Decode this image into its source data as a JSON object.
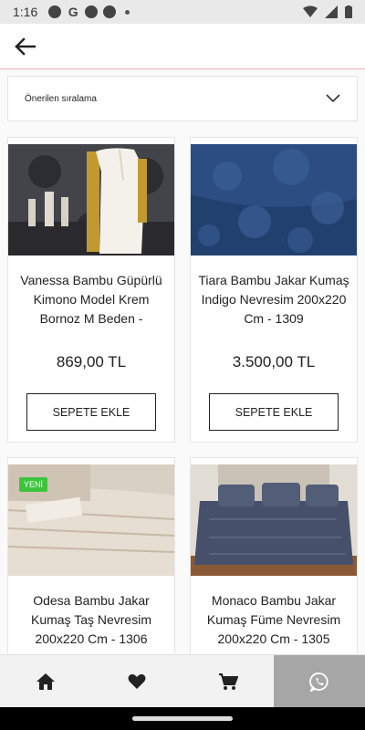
{
  "status_bar": {
    "time": "1:16",
    "g_label": "G"
  },
  "sort": {
    "label": "Önerilen sıralama"
  },
  "products": [
    {
      "title": "Vanessa Bambu Güpürlü Kimono Model Krem Bornoz M Beden -",
      "price": "869,00 TL",
      "button": "SEPETE EKLE",
      "badge": "",
      "image_icon": "bathrobe-photo"
    },
    {
      "title": "Tiara Bambu Jakar Kumaş Indigo Nevresim 200x220 Cm - 1309",
      "price": "3.500,00 TL",
      "button": "SEPETE EKLE",
      "badge": "",
      "image_icon": "duvet-indigo-photo"
    },
    {
      "title": "Odesa Bambu Jakar Kumaş Taş Nevresim 200x220 Cm - 1306",
      "price": "",
      "button": "",
      "badge": "YENİ",
      "image_icon": "duvet-stone-photo"
    },
    {
      "title": "Monaco Bambu Jakar Kumaş Füme Nevresim 200x220 Cm - 1305",
      "price": "",
      "button": "",
      "badge": "",
      "image_icon": "duvet-smoke-photo"
    }
  ],
  "nav": [
    {
      "icon": "home-icon"
    },
    {
      "icon": "heart-icon"
    },
    {
      "icon": "cart-icon"
    },
    {
      "icon": "whatsapp-icon",
      "active": true
    }
  ],
  "colors": {
    "badge": "#3cc53c",
    "active_nav": "#a6a6a6",
    "header_border": "#e9b9b9"
  }
}
